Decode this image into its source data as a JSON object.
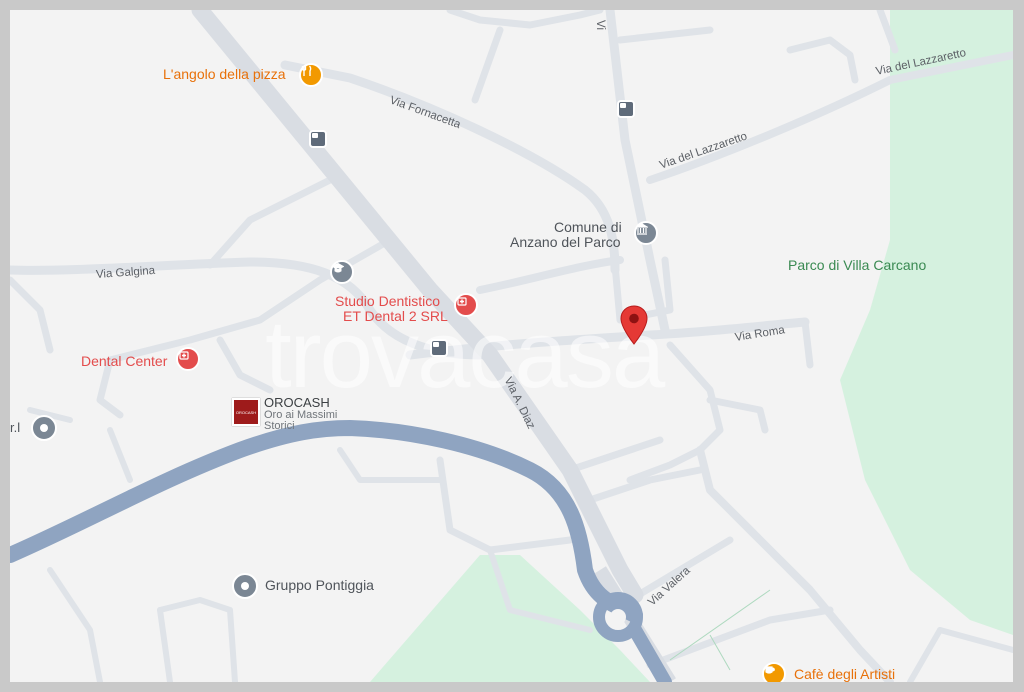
{
  "map": {
    "watermark": "trovacasa",
    "places": {
      "pizza": "L'angolo della pizza",
      "comune_line1": "Comune di",
      "comune_line2": "Anzano del Parco",
      "parco": "Parco di Villa Carcano",
      "studio_line1": "Studio Dentistico",
      "studio_line2": "ET Dental 2 SRL",
      "dental_center": "Dental Center",
      "orocash_title": "OROCASH",
      "orocash_sub1": "Oro ai Massimi",
      "orocash_sub2": "Storici",
      "orocash_logo": "OROCASH",
      "gruppo": "Gruppo Pontiggia",
      "srl_fragment": "r.l",
      "cafe": "Cafè degli Artisti"
    },
    "roads": {
      "fornacetta": "Via Fornacetta",
      "lazzaretto1": "Via del Lazzaretto",
      "lazzaretto2": "Via del Lazzaretto",
      "galgina": "Via Galgina",
      "roma": "Via Roma",
      "diaz": "Via A. Diaz",
      "valera": "Via Valera",
      "top_fragment": "Vi"
    },
    "icons": {
      "pizza": "restaurant-icon",
      "comune": "government-building-icon",
      "school": "school-icon",
      "studio": "medical-icon",
      "dental": "medical-icon",
      "gruppo": "place-icon",
      "srl": "place-icon",
      "cafe": "cafe-icon",
      "bus": "bus-stop-icon",
      "marker": "location-pin-icon"
    },
    "colors": {
      "background": "#f3f3f3",
      "road": "#dfe3e8",
      "highway": "#8fa4c1",
      "park": "#d5f1df",
      "marker": "#e53935",
      "orange": "#e8710a",
      "red": "#e34c4c"
    }
  }
}
